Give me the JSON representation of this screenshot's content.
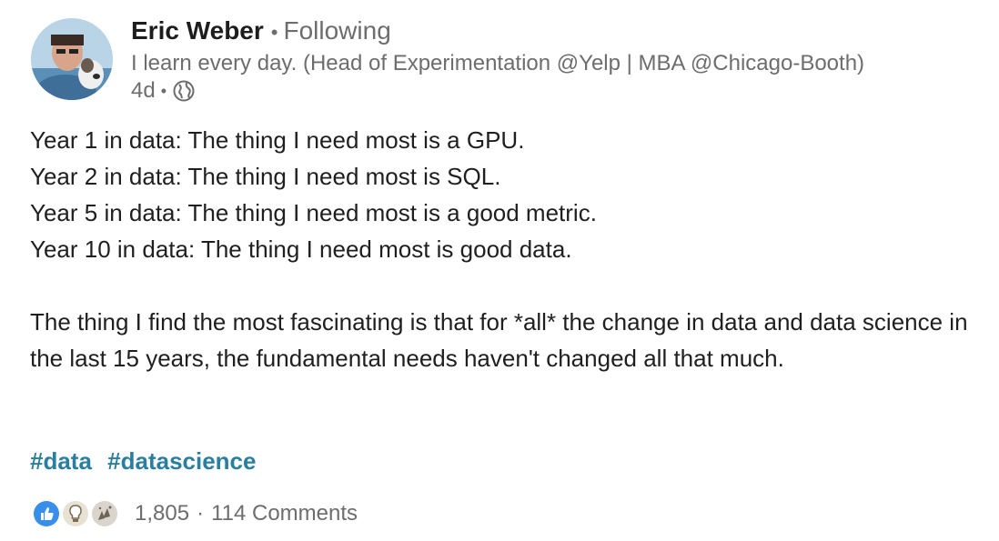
{
  "author": {
    "name": "Eric Weber",
    "follow_status": "Following",
    "headline": "I learn every day. (Head of Experimentation @Yelp | MBA @Chicago-Booth)",
    "time_ago": "4d"
  },
  "post": {
    "lines": [
      "Year 1 in data: The thing I need most is a GPU.",
      "Year 2 in data: The thing I need most is SQL.",
      "Year 5 in data: The thing I need most is a good metric.",
      "Year 10 in data: The thing I need most is good data."
    ],
    "paragraph": "The thing I find the most fascinating is that for *all* the change in data and data science in the last 15 years, the fundamental needs haven't changed all that much.",
    "hashtags": [
      "#data",
      "#datascience"
    ]
  },
  "social": {
    "reaction_icons": [
      "like-icon",
      "insightful-icon",
      "celebrate-icon"
    ],
    "reaction_count": "1,805",
    "separator": "·",
    "comments": "114 Comments"
  },
  "colors": {
    "hashtag": "#2a7fa0",
    "muted": "#6d6d6d",
    "like_blue": "#378fe9"
  }
}
